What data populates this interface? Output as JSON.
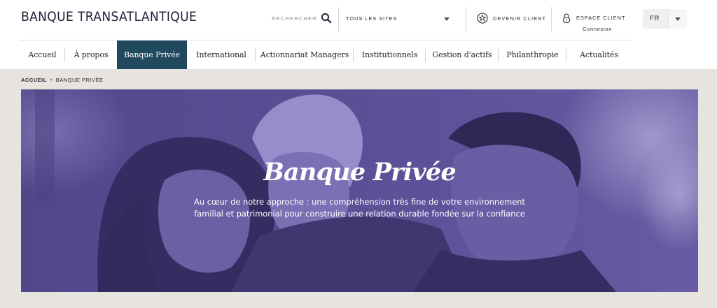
{
  "header": {
    "logo": "BANQUE TRANSATLANTIQUE",
    "search_label": "RECHERCHER",
    "search_icon": "search-icon",
    "sites_select": {
      "value": "TOUS LES SITES"
    },
    "become_client": {
      "label": "DEVENIR CLIENT",
      "icon": "star-badge-icon"
    },
    "client_space": {
      "label": "ESPACE CLIENT",
      "sublabel": "Connexion",
      "icon": "lock-icon"
    },
    "language": {
      "value": "FR"
    }
  },
  "nav": {
    "items": [
      {
        "label": "Accueil"
      },
      {
        "label": "À propos"
      },
      {
        "label": "Banque Privée"
      },
      {
        "label": "International"
      },
      {
        "label": "Actionnariat Managers"
      },
      {
        "label": "Institutionnels"
      },
      {
        "label": "Gestion d'actifs"
      },
      {
        "label": "Philanthropie"
      },
      {
        "label": "Actualités"
      }
    ],
    "active_color": "#21495e"
  },
  "breadcrumb": {
    "home": "ACCUEIL",
    "current": "BANQUE PRIVÉE"
  },
  "hero": {
    "title": "Banque Privée",
    "description_line1": "Au cœur de notre approche : une compréhension très fine de votre environnement",
    "description_line2": "familial et patrimonial pour construire une relation durable fondée sur la confiance",
    "overlay_color": "#5a4f94"
  }
}
